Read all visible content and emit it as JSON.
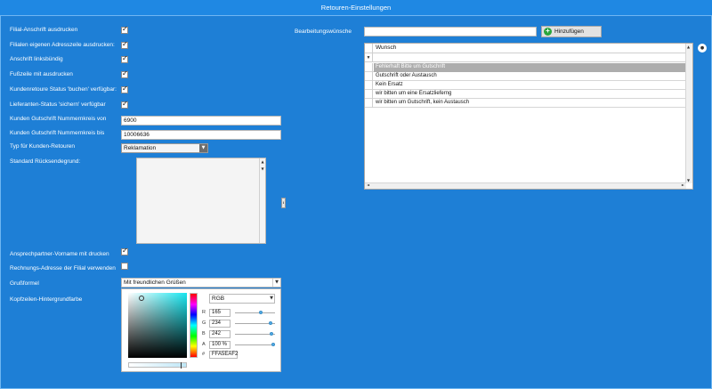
{
  "window": {
    "title": "Retouren-Einstellungen"
  },
  "settings": {
    "filiale_anschrift": {
      "label": "Filial-Anschrift ausdrucken",
      "checked": true
    },
    "filialen_adresszeile": {
      "label": "Filialen eigenen Adresszeile ausdrucken:",
      "checked": true
    },
    "anschrift_linksbuendig": {
      "label": "Anschrift linksbündig",
      "checked": true
    },
    "fusszeile": {
      "label": "Fußzeile mit ausdrucken",
      "checked": true
    },
    "kundenretoure_status": {
      "label": "Kundenretoure Status 'buchen' verfügbar:",
      "checked": true
    },
    "lieferanten_status": {
      "label": "Lieferanten-Status 'sichern' verfügbar",
      "checked": true
    },
    "gutschrift_von": {
      "label": "Kunden Gutschrift Nummernkreis von",
      "value": "6900"
    },
    "gutschrift_bis": {
      "label": "Kunden Gutschrift Nummernkreis bis",
      "value": "10006636"
    },
    "typ": {
      "label": "Typ für Kunden-Retouren",
      "value": "Reklamation"
    },
    "standard_ruecksendegrund": {
      "label": "Standard Rücksendegrund:"
    },
    "ansprechpartner": {
      "label": "Ansprechpartner-Vorname mit drucken",
      "checked": true
    },
    "rechnungsadresse": {
      "label": "Rechnungs-Adresse der Filial verwenden",
      "checked": false
    },
    "grussformel": {
      "label": "Grußformel",
      "value": "Mit freundlichen Grüßen"
    },
    "kopfzeilen_farbe": {
      "label": "Kopfzeilen-Hintergrundfarbe"
    }
  },
  "color_picker": {
    "mode": "RGB",
    "r_label": "R",
    "g_label": "G",
    "b_label": "B",
    "a_label": "A",
    "hex_label": "#",
    "r": "165",
    "g": "234",
    "b": "242",
    "a": "100 %",
    "hex": "FFA5EAF2",
    "r_level": 0.65,
    "g_level": 0.92,
    "b_level": 0.95,
    "a_level": 1.0
  },
  "bearbeitung": {
    "label": "Bearbeitungswünsche",
    "input_value": "",
    "add_button": "Hinzufügen",
    "column": "Wunsch",
    "rows": [
      "Fehlerhaft Bitte um Gutschrift",
      "Gutschrift oder Austausch",
      "Kein Ersatz",
      "wir bitten um eine Ersatzlieferng",
      "wir bitten um Gutschrift, kein Austausch"
    ],
    "selected_index": 0
  },
  "glyphs": {
    "check": "✓",
    "arrow_down": "▼",
    "arrow_up": "▲",
    "arrow_left": "◄",
    "arrow_right": "►",
    "filter": "▼",
    "plus": "+",
    "dot": "●",
    "splitter": "‖"
  }
}
